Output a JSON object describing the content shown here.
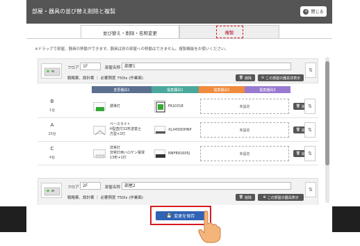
{
  "modal": {
    "title": "部屋・器具の並び替え削除と複製",
    "close_label": "閉じる",
    "close_icon": "×"
  },
  "tabs": [
    {
      "label": "並び替え・削除・名称変更",
      "active": true
    },
    {
      "label": "複製",
      "active": false
    }
  ],
  "note": "※ドラッグで部屋、器具の移動ができます。器具は別の部屋への移動はできません。複製機能をお使いください。",
  "rooms": [
    {
      "floor_label": "フロア",
      "floor_value": "1F",
      "room_name_label": "部屋名称",
      "room_name_value": "部屋1",
      "meta": "戦略案、設計案 ｜ 必要照度 750lx (作業面)",
      "delete_label": "削除",
      "show_label": "この部屋の器具非表示",
      "handle_icon": "⇅"
    },
    {
      "floor_label": "フロア",
      "floor_value": "2F",
      "room_name_label": "部屋名称",
      "room_name_value": "部屋2",
      "meta": "戦略案、設計案 ｜ 必要照度 750lx (作業面)",
      "delete_label": "削除",
      "show_label": "この部屋の器具表示",
      "handle_icon": "⇅"
    }
  ],
  "columns": [
    {
      "label": "変更器具1",
      "color": "#5b6f8f"
    },
    {
      "label": "提案器具1",
      "color": "#4aa89c"
    },
    {
      "label": "提案器具2",
      "color": "#f08a3c"
    },
    {
      "label": "提案器具3",
      "color": "#9a7ad0"
    }
  ],
  "rows": [
    {
      "code": "B",
      "qty": "1台",
      "name": "誘導灯",
      "model": "FA10318",
      "unset": "未設定",
      "delete_label": "削除"
    },
    {
      "code": "A",
      "qty": "25台",
      "name": "ベースライト\nH型直付32形逆富士\n方型+2灯",
      "model": "XLX450DHNP",
      "unset": "未設定",
      "delete_label": "削除"
    },
    {
      "code": "C",
      "qty": "4台",
      "name": "非常灯\n非常灯用ハロゲン電球\n13形+1灯",
      "model": "NNFB91605J",
      "unset": "未設定",
      "delete_label": "削除"
    }
  ],
  "save_label": "変更を保存",
  "save_icon": "💾"
}
